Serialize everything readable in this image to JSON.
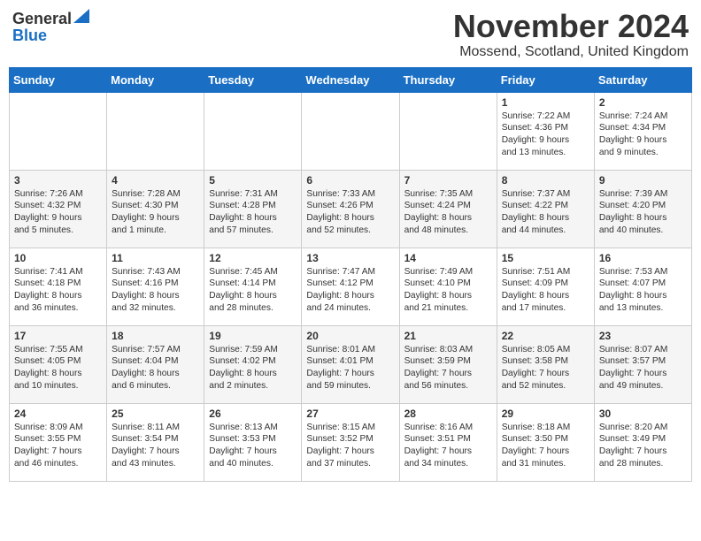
{
  "header": {
    "logo_general": "General",
    "logo_blue": "Blue",
    "month": "November 2024",
    "location": "Mossend, Scotland, United Kingdom"
  },
  "days_of_week": [
    "Sunday",
    "Monday",
    "Tuesday",
    "Wednesday",
    "Thursday",
    "Friday",
    "Saturday"
  ],
  "weeks": [
    [
      {
        "day": "",
        "info": ""
      },
      {
        "day": "",
        "info": ""
      },
      {
        "day": "",
        "info": ""
      },
      {
        "day": "",
        "info": ""
      },
      {
        "day": "",
        "info": ""
      },
      {
        "day": "1",
        "info": "Sunrise: 7:22 AM\nSunset: 4:36 PM\nDaylight: 9 hours\nand 13 minutes."
      },
      {
        "day": "2",
        "info": "Sunrise: 7:24 AM\nSunset: 4:34 PM\nDaylight: 9 hours\nand 9 minutes."
      }
    ],
    [
      {
        "day": "3",
        "info": "Sunrise: 7:26 AM\nSunset: 4:32 PM\nDaylight: 9 hours\nand 5 minutes."
      },
      {
        "day": "4",
        "info": "Sunrise: 7:28 AM\nSunset: 4:30 PM\nDaylight: 9 hours\nand 1 minute."
      },
      {
        "day": "5",
        "info": "Sunrise: 7:31 AM\nSunset: 4:28 PM\nDaylight: 8 hours\nand 57 minutes."
      },
      {
        "day": "6",
        "info": "Sunrise: 7:33 AM\nSunset: 4:26 PM\nDaylight: 8 hours\nand 52 minutes."
      },
      {
        "day": "7",
        "info": "Sunrise: 7:35 AM\nSunset: 4:24 PM\nDaylight: 8 hours\nand 48 minutes."
      },
      {
        "day": "8",
        "info": "Sunrise: 7:37 AM\nSunset: 4:22 PM\nDaylight: 8 hours\nand 44 minutes."
      },
      {
        "day": "9",
        "info": "Sunrise: 7:39 AM\nSunset: 4:20 PM\nDaylight: 8 hours\nand 40 minutes."
      }
    ],
    [
      {
        "day": "10",
        "info": "Sunrise: 7:41 AM\nSunset: 4:18 PM\nDaylight: 8 hours\nand 36 minutes."
      },
      {
        "day": "11",
        "info": "Sunrise: 7:43 AM\nSunset: 4:16 PM\nDaylight: 8 hours\nand 32 minutes."
      },
      {
        "day": "12",
        "info": "Sunrise: 7:45 AM\nSunset: 4:14 PM\nDaylight: 8 hours\nand 28 minutes."
      },
      {
        "day": "13",
        "info": "Sunrise: 7:47 AM\nSunset: 4:12 PM\nDaylight: 8 hours\nand 24 minutes."
      },
      {
        "day": "14",
        "info": "Sunrise: 7:49 AM\nSunset: 4:10 PM\nDaylight: 8 hours\nand 21 minutes."
      },
      {
        "day": "15",
        "info": "Sunrise: 7:51 AM\nSunset: 4:09 PM\nDaylight: 8 hours\nand 17 minutes."
      },
      {
        "day": "16",
        "info": "Sunrise: 7:53 AM\nSunset: 4:07 PM\nDaylight: 8 hours\nand 13 minutes."
      }
    ],
    [
      {
        "day": "17",
        "info": "Sunrise: 7:55 AM\nSunset: 4:05 PM\nDaylight: 8 hours\nand 10 minutes."
      },
      {
        "day": "18",
        "info": "Sunrise: 7:57 AM\nSunset: 4:04 PM\nDaylight: 8 hours\nand 6 minutes."
      },
      {
        "day": "19",
        "info": "Sunrise: 7:59 AM\nSunset: 4:02 PM\nDaylight: 8 hours\nand 2 minutes."
      },
      {
        "day": "20",
        "info": "Sunrise: 8:01 AM\nSunset: 4:01 PM\nDaylight: 7 hours\nand 59 minutes."
      },
      {
        "day": "21",
        "info": "Sunrise: 8:03 AM\nSunset: 3:59 PM\nDaylight: 7 hours\nand 56 minutes."
      },
      {
        "day": "22",
        "info": "Sunrise: 8:05 AM\nSunset: 3:58 PM\nDaylight: 7 hours\nand 52 minutes."
      },
      {
        "day": "23",
        "info": "Sunrise: 8:07 AM\nSunset: 3:57 PM\nDaylight: 7 hours\nand 49 minutes."
      }
    ],
    [
      {
        "day": "24",
        "info": "Sunrise: 8:09 AM\nSunset: 3:55 PM\nDaylight: 7 hours\nand 46 minutes."
      },
      {
        "day": "25",
        "info": "Sunrise: 8:11 AM\nSunset: 3:54 PM\nDaylight: 7 hours\nand 43 minutes."
      },
      {
        "day": "26",
        "info": "Sunrise: 8:13 AM\nSunset: 3:53 PM\nDaylight: 7 hours\nand 40 minutes."
      },
      {
        "day": "27",
        "info": "Sunrise: 8:15 AM\nSunset: 3:52 PM\nDaylight: 7 hours\nand 37 minutes."
      },
      {
        "day": "28",
        "info": "Sunrise: 8:16 AM\nSunset: 3:51 PM\nDaylight: 7 hours\nand 34 minutes."
      },
      {
        "day": "29",
        "info": "Sunrise: 8:18 AM\nSunset: 3:50 PM\nDaylight: 7 hours\nand 31 minutes."
      },
      {
        "day": "30",
        "info": "Sunrise: 8:20 AM\nSunset: 3:49 PM\nDaylight: 7 hours\nand 28 minutes."
      }
    ]
  ]
}
